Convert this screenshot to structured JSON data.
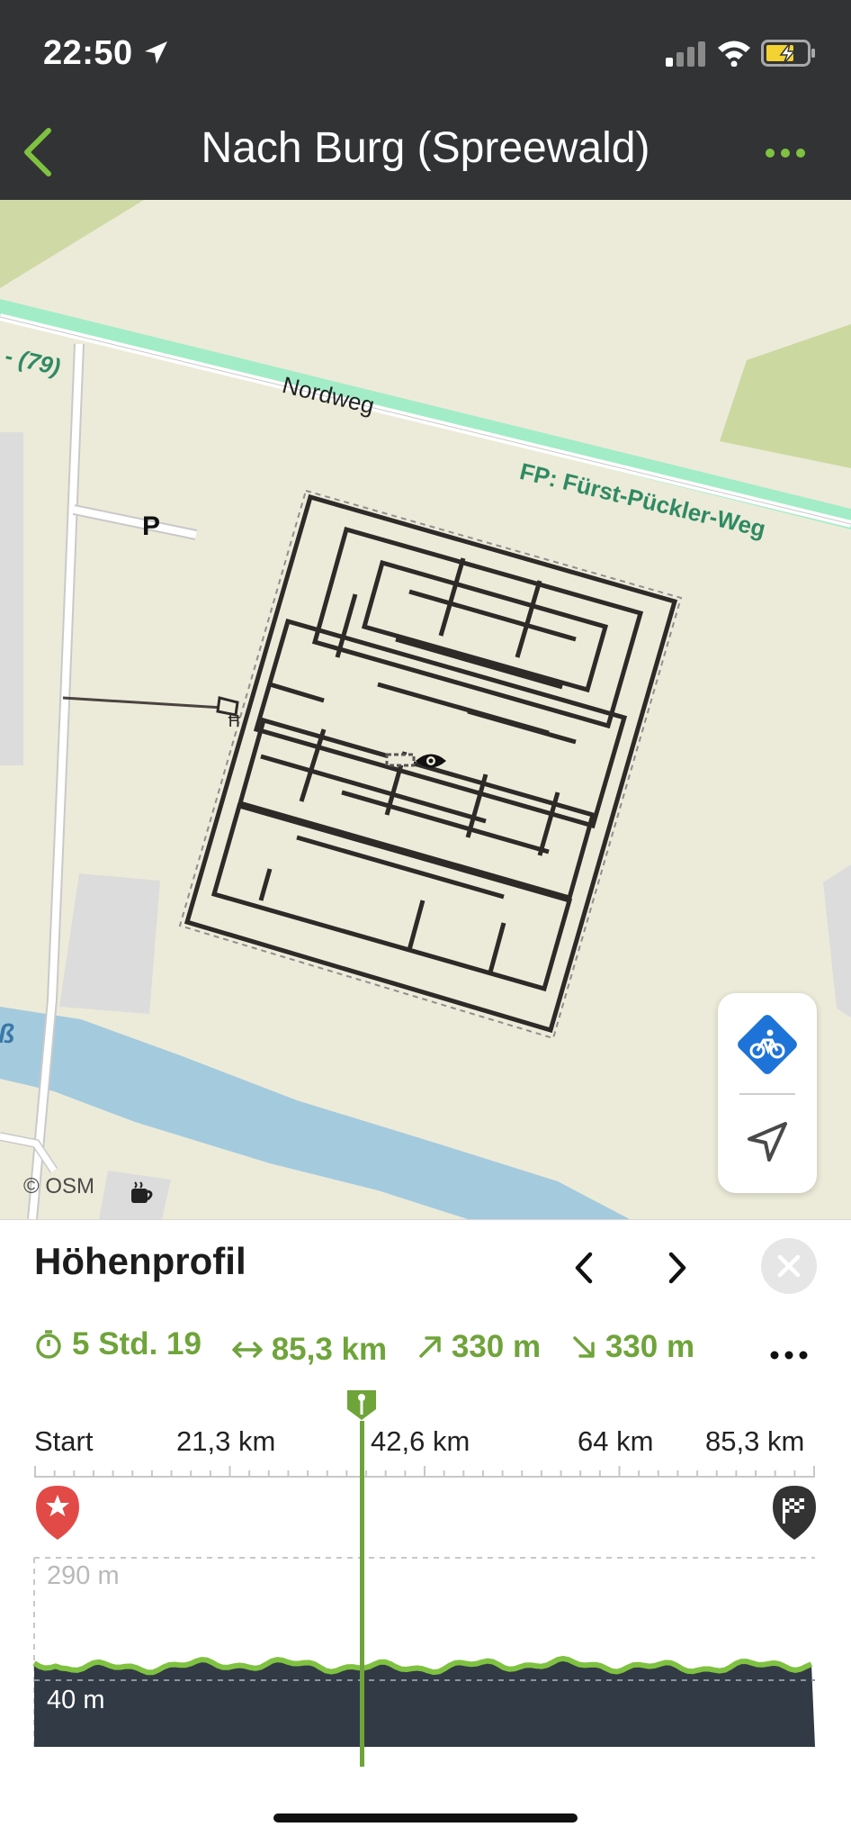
{
  "status_bar": {
    "time": "22:50",
    "icons": [
      "location-arrow-icon",
      "cellular-signal-icon",
      "wifi-icon",
      "battery-charging-icon"
    ]
  },
  "nav": {
    "title": "Nach Burg (Spreewald)",
    "back_icon": "chevron-left-icon",
    "more_icon": "more-dots-icon"
  },
  "map": {
    "labels": {
      "route_number": ") - (79)",
      "street": "Nordweg",
      "trail": "FP: Fürst-Pückler-Weg",
      "parking": "P",
      "water_fragment": "ß"
    },
    "attribution": "© OSM",
    "controls": [
      "bike-mode-icon",
      "navigate-arrow-icon"
    ],
    "colors": {
      "land": "#ecebd9",
      "trail": "#a2ecc8",
      "water": "#a4cade",
      "meadow": "#cbd8a0",
      "building": "#dcdcdc"
    }
  },
  "panel": {
    "title": "Höhenprofil",
    "stats": {
      "duration": "5 Std. 19",
      "distance": "85,3 km",
      "ascent": "330 m",
      "descent": "330 m"
    },
    "axis_ticks": [
      "Start",
      "21,3 km",
      "42,6 km",
      "64 km",
      "85,3 km"
    ],
    "elevation_labels": {
      "max": "290 m",
      "min": "40 m"
    },
    "scrubber_position_fraction": 0.42,
    "colors": {
      "accent": "#6fa43a",
      "profile_fill": "#323a46",
      "start_pin": "#e24a47",
      "finish_pin": "#333333"
    }
  }
}
